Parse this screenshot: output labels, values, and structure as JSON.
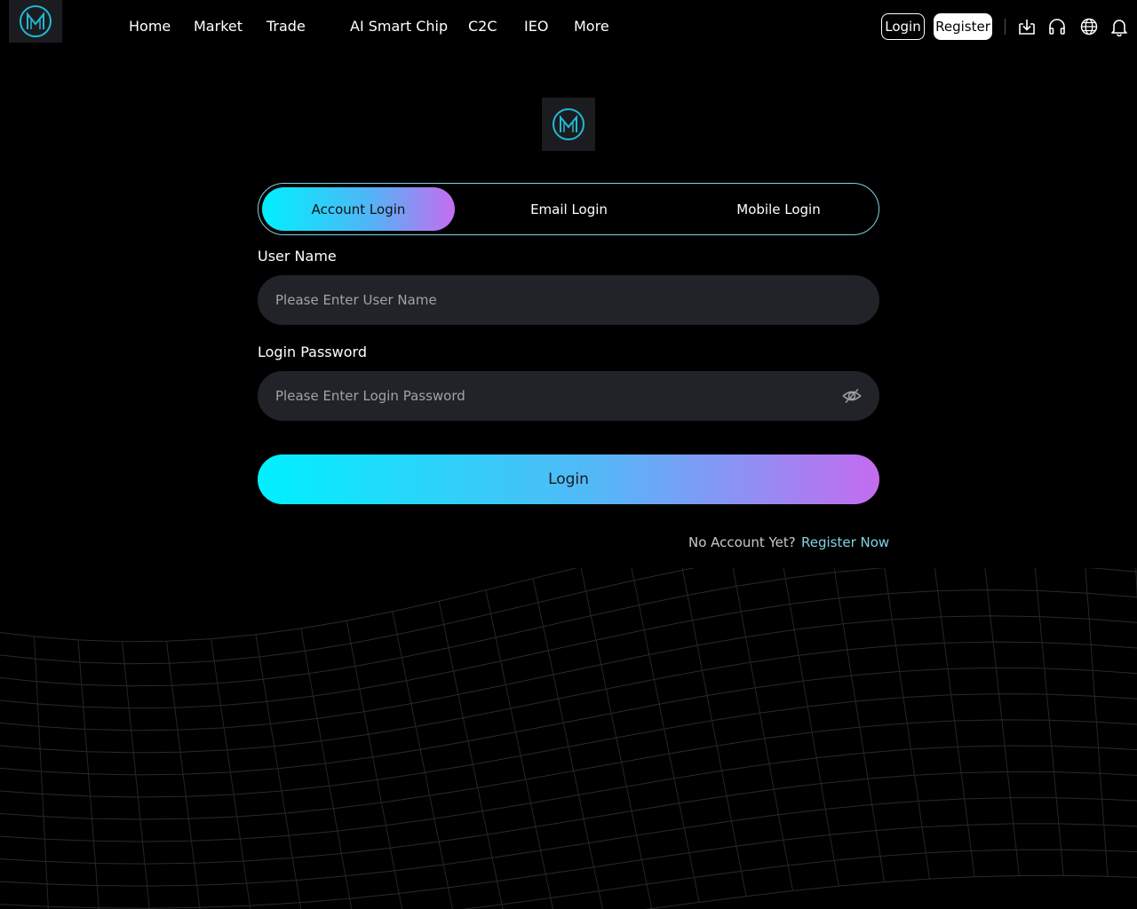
{
  "nav": {
    "items": [
      "Home",
      "Market",
      "Trade",
      "AI Smart Chip",
      "C2C",
      "IEO",
      "More"
    ],
    "login_label": "Login",
    "register_label": "Register",
    "icons": [
      "download-icon",
      "headset-icon",
      "globe-icon",
      "bell-icon"
    ]
  },
  "tabs": [
    "Account Login",
    "Email Login",
    "Mobile Login"
  ],
  "form": {
    "username_label": "User Name",
    "username_placeholder": "Please Enter User Name",
    "password_label": "Login Password",
    "password_placeholder": "Please Enter Login Password",
    "submit_label": "Login"
  },
  "footer": {
    "no_account": "No Account Yet?",
    "register_now": "Register Now"
  },
  "colors": {
    "accent_cyan": "#00f0ff",
    "accent_purple": "#c66cf0",
    "link": "#7fd3e0",
    "field_bg": "#222328"
  }
}
